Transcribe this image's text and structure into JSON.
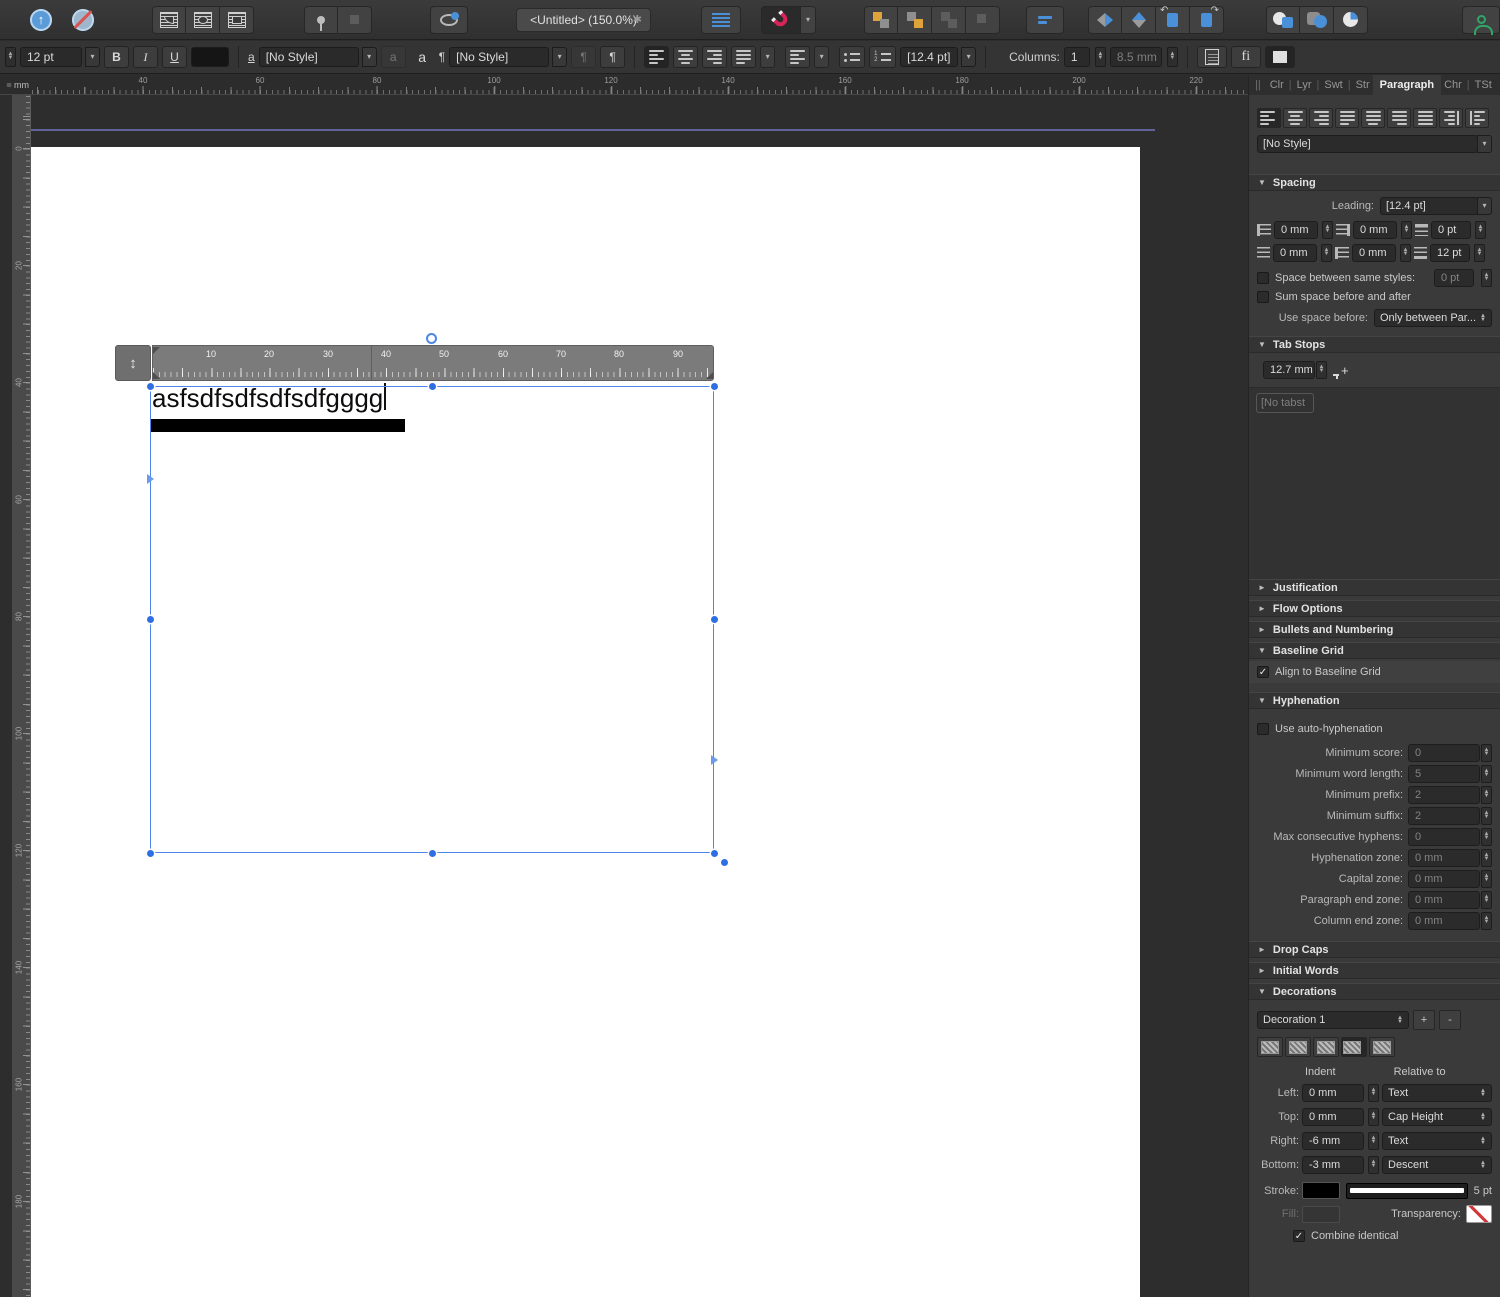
{
  "colors": {
    "accent_blue": "#4a90d9",
    "selection_blue": "#2f6fe4",
    "magnet_red": "#d82458",
    "arrange_orange": "#dfa33b",
    "person_green": "#2fa768",
    "guide_purple": "#62629b"
  },
  "glyphs": {
    "check": "✓",
    "star": "✱",
    "updown": "↕",
    "plus": "+",
    "minus": "-",
    "pilcrow": "¶",
    "char_a": "a",
    "bold": "B",
    "italic": "I",
    "underline": "U",
    "fi": "fi",
    "double_bar": "||"
  },
  "app": {
    "title": "<Untitled> (150.0%)",
    "unit": "mm"
  },
  "context": {
    "font_size": "12 pt",
    "char_style": "[No Style]",
    "para_style": "[No Style]",
    "leading": "[12.4 pt]",
    "columns_label": "Columns:",
    "columns": "1",
    "gutter": "8.5 mm"
  },
  "ptabs": {
    "collapse": "||",
    "items": [
      "Clr",
      "Lyr",
      "Swt",
      "Str",
      "Paragraph",
      "Chr",
      "TSt"
    ],
    "active": "Paragraph"
  },
  "panel": {
    "style_value": "[No Style]",
    "spacing": {
      "title": "Spacing",
      "leading_label": "Leading:",
      "leading_value": "[12.4 pt]",
      "f1": "0 mm",
      "f2": "0 mm",
      "f3": "0 pt",
      "f4": "0 mm",
      "f5": "0 mm",
      "f6": "12 pt",
      "same_styles_label": "Space between same styles:",
      "same_styles_value": "0 pt",
      "sum_label": "Sum space before and after",
      "use_before_label": "Use space before:",
      "use_before_value": "Only between Par..."
    },
    "tab_stops": {
      "title": "Tab Stops",
      "default_value": "12.7 mm",
      "empty": "[No tabst"
    },
    "justification_title": "Justification",
    "flow_title": "Flow Options",
    "bullets_title": "Bullets and Numbering",
    "baseline": {
      "title": "Baseline Grid",
      "align_label": "Align to Baseline Grid",
      "checked": true
    },
    "hyphenation": {
      "title": "Hyphenation",
      "auto_label": "Use auto-hyphenation",
      "checked": false,
      "rows": [
        {
          "label": "Minimum score:",
          "value": "0"
        },
        {
          "label": "Minimum word length:",
          "value": "5"
        },
        {
          "label": "Minimum prefix:",
          "value": "2"
        },
        {
          "label": "Minimum suffix:",
          "value": "2"
        },
        {
          "label": "Max consecutive hyphens:",
          "value": "0"
        },
        {
          "label": "Hyphenation zone:",
          "value": "0 mm"
        },
        {
          "label": "Capital zone:",
          "value": "0 mm"
        },
        {
          "label": "Paragraph end zone:",
          "value": "0 mm"
        },
        {
          "label": "Column end zone:",
          "value": "0 mm"
        }
      ]
    },
    "drop_caps_title": "Drop Caps",
    "initial_words_title": "Initial Words",
    "decorations": {
      "title": "Decorations",
      "selector": "Decoration 1",
      "selected_pattern_index": 3,
      "indent_header": "Indent",
      "relative_header": "Relative to",
      "rows": [
        {
          "label": "Left:",
          "value": "0 mm",
          "relative": "Text"
        },
        {
          "label": "Top:",
          "value": "0 mm",
          "relative": "Cap Height"
        },
        {
          "label": "Right:",
          "value": "-6 mm",
          "relative": "Text"
        },
        {
          "label": "Bottom:",
          "value": "-3 mm",
          "relative": "Descent"
        }
      ],
      "stroke_label": "Stroke:",
      "stroke_width": "5 pt",
      "fill_label": "Fill:",
      "transparency_label": "Transparency:",
      "combine_label": "Combine identical",
      "combine_checked": true
    }
  },
  "canvas": {
    "text": "asfsdfsdfsdfsdfgggg",
    "frame_ruler": [
      "10",
      "20",
      "30",
      "40",
      "50",
      "60",
      "70",
      "80",
      "90"
    ],
    "ruler_top": [
      "40",
      "60",
      "80",
      "100",
      "120",
      "140",
      "160",
      "180",
      "200",
      "220"
    ],
    "ruler_left": [
      "0",
      "20",
      "40",
      "60",
      "80",
      "100",
      "120",
      "140",
      "160",
      "180"
    ]
  }
}
